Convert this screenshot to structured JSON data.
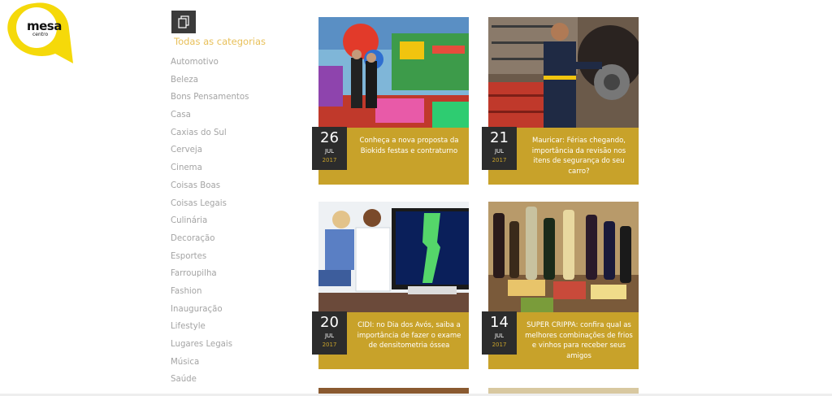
{
  "brand": {
    "name": "mesa",
    "sub": "centro",
    "accent": "#f5d90a",
    "gold": "#c8a22a"
  },
  "categories": {
    "title": "Todas as categorias",
    "icon": "documents-icon",
    "items": [
      "Automotivo",
      "Beleza",
      "Bons Pensamentos",
      "Casa",
      "Caxias do Sul",
      "Cerveja",
      "Cinema",
      "Coisas Boas",
      "Coisas Legais",
      "Culinária",
      "Decoração",
      "Esportes",
      "Farroupilha",
      "Fashion",
      "Inauguração",
      "Lifestyle",
      "Lugares Legais",
      "Música",
      "Saúde"
    ]
  },
  "posts": [
    {
      "day": "26",
      "month": "JUL",
      "year": "2017",
      "title": "Conheça a nova proposta da Biokids festas e contraturno"
    },
    {
      "day": "21",
      "month": "JUL",
      "year": "2017",
      "title": "Mauricar: Férias chegando, importância da revisão nos itens de segurança do seu carro?"
    },
    {
      "day": "20",
      "month": "JUL",
      "year": "2017",
      "title": "CIDI: no Dia dos Avós, saiba a importância de fazer o exame de densitometria óssea"
    },
    {
      "day": "14",
      "month": "JUL",
      "year": "2017",
      "title": "SUPER CRIPPA: confira qual as melhores combinações de frios e vinhos para receber seus amigos"
    }
  ]
}
